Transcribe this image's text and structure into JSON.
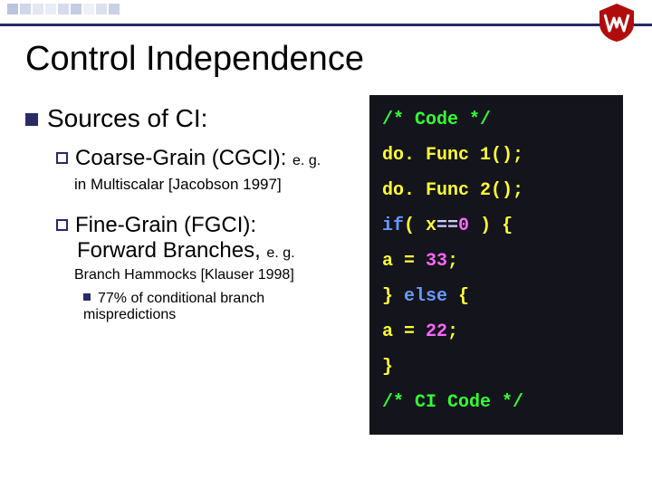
{
  "deco": {
    "colors": [
      "#b9c4de",
      "#cfd7ea",
      "#e2e7f2",
      "#e9edf6",
      "#d6dced",
      "#c4cde3",
      "#eef1f8",
      "#dbe1ef",
      "#c9d1e5"
    ]
  },
  "title": "Control Independence",
  "sources": {
    "heading": "Sources of CI:",
    "item1": {
      "label": "Coarse-Grain (CGCI):",
      "suffix": "e. g.",
      "note": "in Multiscalar [Jacobson 1997]"
    },
    "item2": {
      "label": "Fine-Grain (FGCI):",
      "line2": "Forward Branches,",
      "suffix": "e. g.",
      "note": "Branch Hammocks [Klauser 1998]",
      "stat": "77% of conditional branch mispredictions"
    }
  },
  "code": {
    "l1a": "/* Code */",
    "l2": "do. Func 1();",
    "l3": "do. Func 2();",
    "l4kw": "if",
    "l4a": "( x",
    "l4b": "==",
    "l4c": "0",
    "l4d": " ) {",
    "l5": "  a = ",
    "l5n": "33",
    "l5e": ";",
    "l6a": "} ",
    "l6kw": "else",
    "l6b": " {",
    "l7": "  a = ",
    "l7n": "22",
    "l7e": ";",
    "l8": "}",
    "l9": "/* CI Code */"
  }
}
